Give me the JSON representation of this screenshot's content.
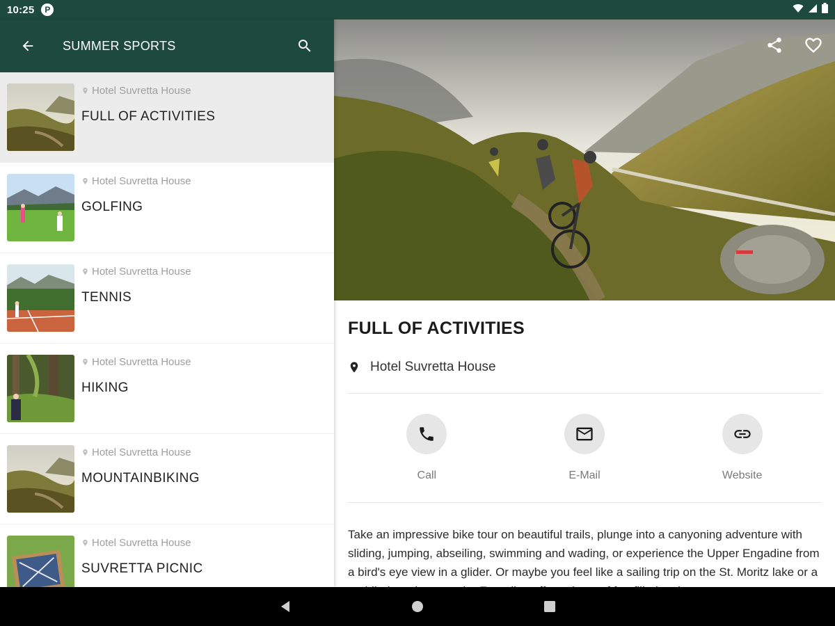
{
  "status_bar": {
    "time": "10:25",
    "app_badge": "P"
  },
  "app_bar": {
    "title": "SUMMER SPORTS"
  },
  "list": [
    {
      "location": "Hotel Suvretta House",
      "title": "FULL OF ACTIVITIES",
      "selected": true
    },
    {
      "location": "Hotel Suvretta House",
      "title": "GOLFING"
    },
    {
      "location": "Hotel Suvretta House",
      "title": "TENNIS"
    },
    {
      "location": "Hotel Suvretta House",
      "title": "HIKING"
    },
    {
      "location": "Hotel Suvretta House",
      "title": "MOUNTAINBIKING"
    },
    {
      "location": "Hotel Suvretta House",
      "title": "SUVRETTA PICNIC"
    }
  ],
  "detail": {
    "title": "FULL OF ACTIVITIES",
    "location": "Hotel Suvretta House",
    "actions": {
      "call": "Call",
      "email": "E-Mail",
      "website": "Website"
    },
    "description": "Take an impressive bike tour on beautiful trails, plunge into a canyoning adventure with sliding, jumping, abseiling, swimming and wading, or experience the Upper Engadine from a bird's eye view in a glider. Or maybe you feel like a sailing trip on the St. Moritz lake or a paddle-board tour — the Engadine offers plenty of fun-filled options."
  },
  "colors": {
    "primary": "#1d4a3c",
    "selected_row": "#ececec",
    "muted_text": "#9e9e9e"
  },
  "icons": [
    "back-arrow-icon",
    "search-icon",
    "location-pin-icon",
    "share-icon",
    "heart-icon",
    "phone-icon",
    "mail-icon",
    "link-icon",
    "wifi-icon",
    "signal-icon",
    "battery-icon",
    "nav-back-icon",
    "nav-home-icon",
    "nav-recents-icon"
  ]
}
